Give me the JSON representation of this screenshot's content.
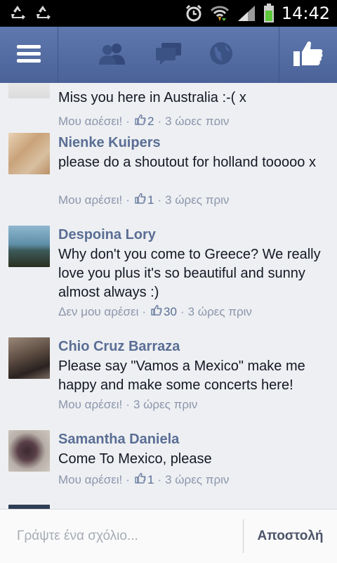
{
  "status_bar": {
    "time": "14:42"
  },
  "comments": [
    {
      "name": "",
      "text": "Miss you here in Australia :-( x",
      "like_label": "Μου αρέσει!",
      "like_count": "2",
      "time": "3 ώρες πριν"
    },
    {
      "name": "Nienke Kuipers",
      "text": "please do a shoutout for holland tooooo x",
      "like_label": "Μου αρέσει!",
      "like_count": "1",
      "time": "3 ώρες πριν"
    },
    {
      "name": "Despoina Lory",
      "text": "Why don't you come to Greece? We really love you plus it's so beautiful and sunny almost always :)",
      "like_label": "Δεν μου αρέσει",
      "like_count": "30",
      "time": "3 ώρες πριν"
    },
    {
      "name": "Chio Cruz Barraza",
      "text": "Please say \"Vamos a Mexico\" make me happy and make some concerts here!",
      "like_label": "Μου αρέσει!",
      "like_count": "",
      "time": "3 ώρες πριν"
    },
    {
      "name": "Samantha Daniela",
      "text": "Come To Mexico, please",
      "like_label": "Μου αρέσει!",
      "like_count": "1",
      "time": "3 ώρες πριν"
    }
  ],
  "composer": {
    "placeholder": "Γράψτε ένα σχόλιο...",
    "send_label": "Αποστολή"
  },
  "colors": {
    "navbar": "#4f67a0",
    "name": "#5a6e95",
    "meta": "#8b95ab",
    "background": "#e9ebee"
  },
  "icons": [
    "recycle-icon",
    "alarm-icon",
    "wifi-icon",
    "signal-icon",
    "battery-icon",
    "menu-icon",
    "friends-icon",
    "messages-icon",
    "globe-icon",
    "like-thumb-icon"
  ]
}
